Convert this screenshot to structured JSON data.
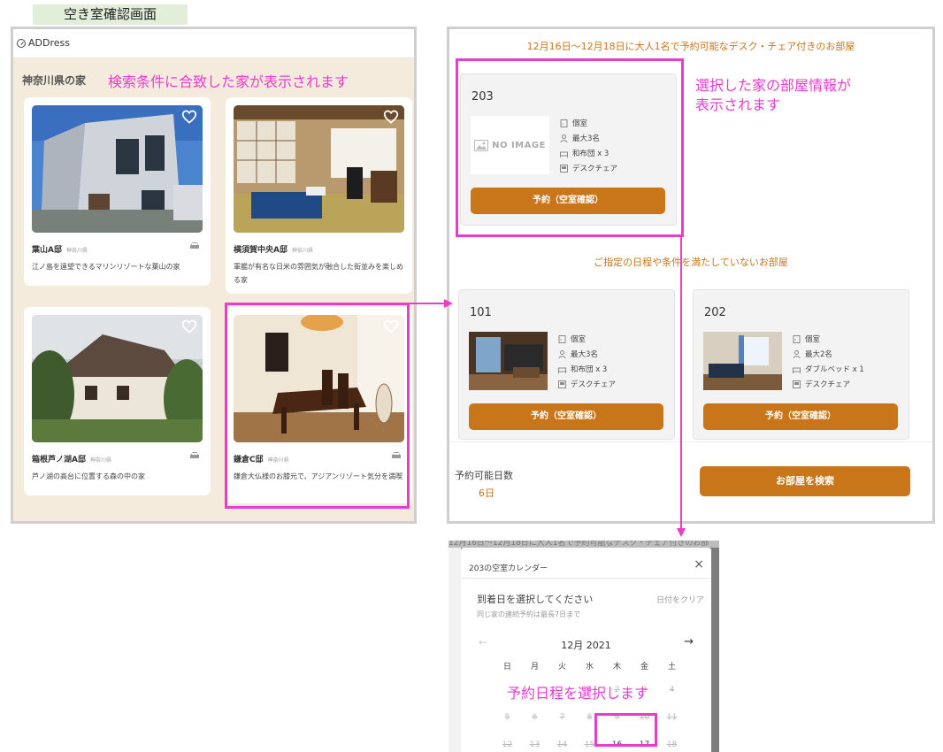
{
  "page_tag": "空き室確認画面",
  "search_screen": {
    "logo_text": "ADDress",
    "pref_title": "神奈川県の家",
    "annotation": "検索条件に合致した家が表示されます",
    "houses": [
      {
        "name": "葉山A邸",
        "pref": "神奈川県",
        "desc": "江ノ島を遠望できるマリンリゾートな葉山の家"
      },
      {
        "name": "横須賀中央A邸",
        "pref": "神奈川県",
        "desc": "軍艦が有名な日米の雰囲気が融合した街並みを楽しめる家"
      },
      {
        "name": "箱根芦ノ湖A邸",
        "pref": "神奈川県",
        "desc": "芦ノ湖の高台に位置する森の中の家"
      },
      {
        "name": "鎌倉C邸",
        "pref": "神奈川県",
        "desc": "鎌倉大仏様のお膝元で、アジアンリゾート気分を満喫"
      }
    ]
  },
  "room_screen": {
    "available_heading": "12月16日～12月18日に大人1名で予約可能なデスク・チェア付きのお部屋",
    "annotation_line1": "選択した家の部屋情報が",
    "annotation_line2": "表示されます",
    "unavailable_heading": "ご指定の日程や条件を満たしていないお部屋",
    "rooms": [
      {
        "number": "203",
        "image_label": "NO IMAGE",
        "type": "個室",
        "capacity": "最大3名",
        "bedding": "和布団 x 3",
        "desk": "デスクチェア",
        "button": "予約（空室確認）"
      },
      {
        "number": "101",
        "type": "個室",
        "capacity": "最大3名",
        "bedding": "和布団 x 3",
        "desk": "デスクチェア",
        "button": "予約（空室確認）"
      },
      {
        "number": "202",
        "type": "個室",
        "capacity": "最大2名",
        "bedding": "ダブルベッド x 1",
        "desk": "デスクチェア",
        "button": "予約（空室確認）"
      }
    ],
    "days_label": "予約可能日数",
    "days_value": "6日",
    "search_button": "お部屋を検索"
  },
  "calendar": {
    "behind_text": "12月16日～12月18日に大人1名で予約可能なデスク・チェア付きのお部",
    "title": "203の空室カレンダー",
    "close": "×",
    "prompt": "到着日を選択してください",
    "clear": "日付をクリア",
    "note": "同じ家の連続予約は最長7日まで",
    "month": "12月 2021",
    "weekdays": [
      "日",
      "月",
      "火",
      "水",
      "木",
      "金",
      "土"
    ],
    "week1": [
      "",
      "",
      "",
      "1",
      "2",
      "3",
      "4"
    ],
    "week2": [
      "5",
      "6",
      "7",
      "8",
      "9",
      "10",
      "11"
    ],
    "week3": [
      "12",
      "13",
      "14",
      "15",
      "16",
      "17",
      "18"
    ],
    "annotation": "予約日程を選択します"
  },
  "colors": {
    "accent": "#c9761a",
    "annotation": "#e83ccd",
    "panel_bg": "#f4ebdc"
  }
}
